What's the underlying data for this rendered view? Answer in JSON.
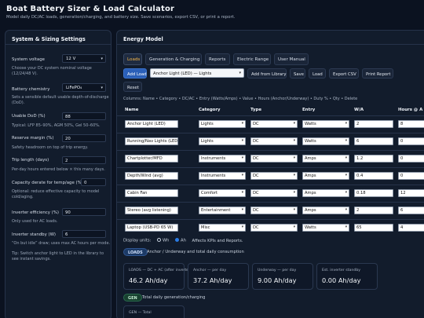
{
  "app": {
    "title": "Boat Battery Sizer & Load Calculator",
    "subtitle": "Model daily DC/AC loads, generation/charging, and battery size. Save scenarios, export CSV, or print a report."
  },
  "settings": {
    "title": "System & Sizing Settings",
    "system_voltage": {
      "label": "System voltage",
      "value": "12 V",
      "hint": "Choose your DC system nominal voltage (12/24/48 V)."
    },
    "battery_chemistry": {
      "label": "Battery chemistry",
      "value": "LiFePO₄",
      "hint": "Sets a sensible default usable depth-of-discharge (DoD)."
    },
    "usable_dod": {
      "label": "Usable DoD (%)",
      "value": "88",
      "hint": "Typical: LFP 85–90%, AGM 50%, Gel 50–60%."
    },
    "reserve_margin": {
      "label": "Reserve margin (%)",
      "value": "20",
      "hint": "Safety headroom on top of trip energy."
    },
    "trip_length": {
      "label": "Trip length (days)",
      "value": "2",
      "hint": "Per-day hours entered below × this many days."
    },
    "capacity_derate": {
      "label": "Capacity derate for temp/age (%)",
      "value": "0",
      "hint": "Optional: reduce effective capacity to model cold/aging."
    },
    "inverter_efficiency": {
      "label": "Inverter efficiency (%)",
      "value": "90",
      "hint": "Only used for AC loads."
    },
    "inverter_standby": {
      "label": "Inverter standby (W)",
      "value": "6",
      "hint": "“On but idle” draw; uses max AC hours per mode."
    },
    "tip": "Tip: Switch anchor light to LED in the library to see instant savings."
  },
  "energy": {
    "title": "Energy Model",
    "tabs": [
      "Loads",
      "Generation & Charging",
      "Reports",
      "Electric Range",
      "User Manual"
    ],
    "toolbar": {
      "add_load": "Add Load",
      "library_selection": "Anchor Light (LED) — Lights",
      "add_from_library": "Add from Library",
      "save": "Save",
      "load": "Load",
      "export_csv": "Export CSV",
      "print_report": "Print Report",
      "reset": "Reset"
    },
    "columns_help": "Columns: Name • Category • DC/AC • Entry (Watts/Amps) • Value • Hours (Anchor/Underway) • Duty % • Qty • Delete",
    "headers": {
      "name": "Name",
      "category": "Category",
      "type": "Type",
      "entry": "Entry",
      "value": "W/A",
      "hours": "Hours @ A"
    },
    "rows": [
      {
        "name": "Anchor Light (LED)",
        "category": "Lights",
        "type": "DC",
        "entry": "Watts",
        "value": "2",
        "hours": "8"
      },
      {
        "name": "Running/Nav Lights (LED)",
        "category": "Lights",
        "type": "DC",
        "entry": "Watts",
        "value": "6",
        "hours": "0"
      },
      {
        "name": "Chartplotter/MFD",
        "category": "Instruments",
        "type": "DC",
        "entry": "Amps",
        "value": "1.2",
        "hours": "0"
      },
      {
        "name": "Depth/Wind (avg)",
        "category": "Instruments",
        "type": "DC",
        "entry": "Amps",
        "value": "0.4",
        "hours": "0"
      },
      {
        "name": "Cabin Fan",
        "category": "Comfort",
        "type": "DC",
        "entry": "Amps",
        "value": "0.18",
        "hours": "12"
      },
      {
        "name": "Stereo (avg listening)",
        "category": "Entertainment",
        "type": "DC",
        "entry": "Amps",
        "value": "2",
        "hours": "6"
      },
      {
        "name": "Laptop (USB-PD 65 W)",
        "category": "Misc",
        "type": "DC",
        "entry": "Watts",
        "value": "65",
        "hours": "4"
      }
    ],
    "display_units": {
      "label": "Display units:",
      "wh": "Wh",
      "ah": "Ah",
      "selected": "Ah",
      "note": "Affects KPIs and Reports."
    },
    "loads_section": {
      "badge": "LOADS",
      "note": "Anchor / Underway and total daily consumption",
      "kpis": [
        {
          "label": "LOADS — DC + AC (after inverter)",
          "value": "46.2 Ah/day"
        },
        {
          "label": "Anchor — per day",
          "value": "37.2 Ah/day"
        },
        {
          "label": "Underway — per day",
          "value": "9.00 Ah/day"
        },
        {
          "label": "Est. inverter standby",
          "value": "0.00 Ah/day"
        }
      ]
    },
    "gen_section": {
      "badge": "GEN",
      "note": "Total daily generation/charging",
      "kpi_label": "GEN — Total"
    }
  },
  "colors": {
    "background": "#0b1220",
    "panel": "#121c2c",
    "accent": "#f5b74a",
    "primary_button": "#2a5fb8"
  }
}
